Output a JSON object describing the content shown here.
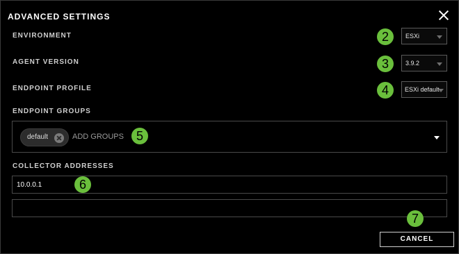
{
  "dialog": {
    "title": "ADVANCED SETTINGS",
    "close_icon": "close-icon"
  },
  "environment": {
    "label": "ENVIRONMENT",
    "value": "ESXi",
    "badge": "2"
  },
  "agent_version": {
    "label": "AGENT VERSION",
    "value": "3.9.2",
    "badge": "3"
  },
  "endpoint_profile": {
    "label": "ENDPOINT PROFILE",
    "value": "ESXi default",
    "badge": "4"
  },
  "endpoint_groups": {
    "label": "ENDPOINT GROUPS",
    "chips": [
      {
        "label": "default"
      }
    ],
    "placeholder": "ADD GROUPS",
    "badge": "5"
  },
  "collector_addresses": {
    "label": "COLLECTOR ADDRESSES",
    "values": [
      "10.0.0.1",
      ""
    ],
    "badge": "6"
  },
  "footer": {
    "cancel_label": "CANCEL",
    "badge": "7"
  },
  "colors": {
    "badge": "#6abf3c",
    "background": "#000000",
    "border": "#4a4a4a"
  }
}
